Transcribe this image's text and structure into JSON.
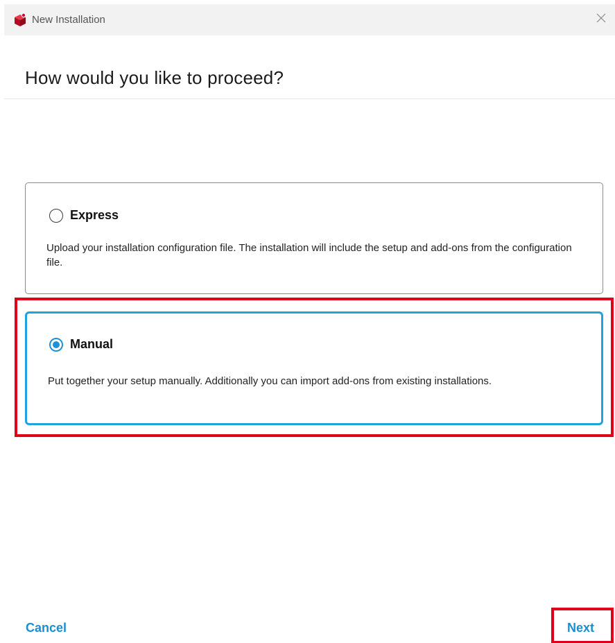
{
  "window": {
    "title": "New Installation",
    "icon": "red-cube-app-icon",
    "close_icon": "close-icon"
  },
  "header": {
    "title": "How would you like to proceed?"
  },
  "options": [
    {
      "label": "Express",
      "description": "Upload your installation configuration file. The installation will include the setup and add-ons from the configuration file.",
      "selected": false
    },
    {
      "label": "Manual",
      "description": "Put together your setup manually. Additionally you can import add-ons from existing installations.",
      "selected": true
    }
  ],
  "footer": {
    "cancel_label": "Cancel",
    "next_label": "Next"
  },
  "colors": {
    "accent": "#1a8fd0",
    "selected_border": "#1fa3dc",
    "highlight": "#e1001a",
    "app_icon": "#c8102e"
  }
}
